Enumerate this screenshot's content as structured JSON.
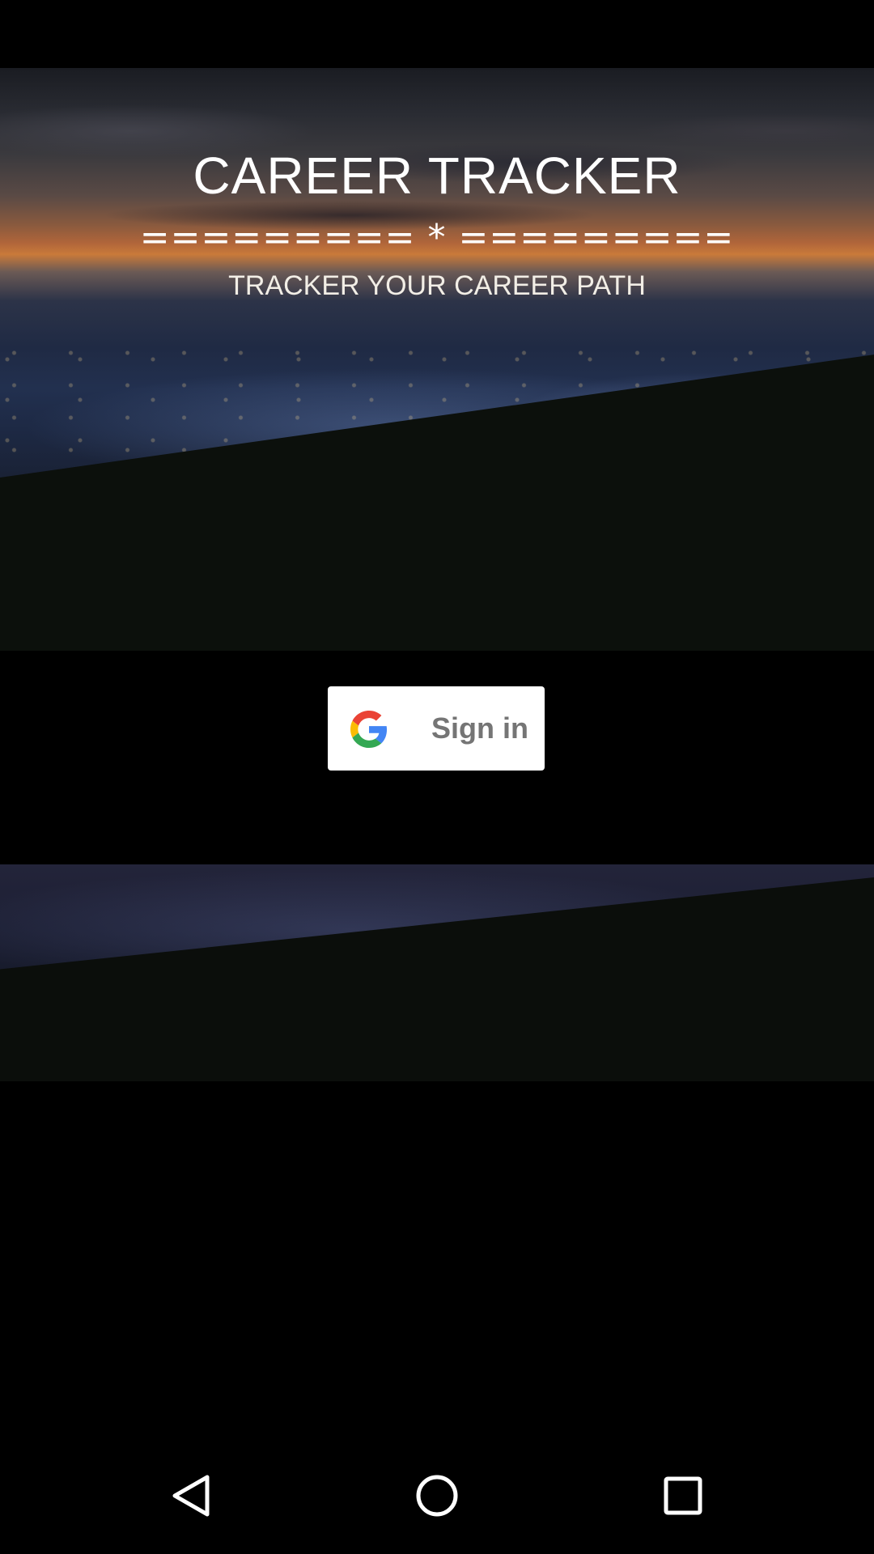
{
  "app": {
    "title": "CAREER TRACKER",
    "divider": "========= * =========",
    "tagline": "TRACKER YOUR CAREER PATH"
  },
  "signin": {
    "label": "Sign in",
    "icon": "google-g-icon"
  },
  "navigation": {
    "back_icon": "back-triangle-icon",
    "home_icon": "home-circle-icon",
    "recent_icon": "recent-apps-square-icon"
  },
  "colors": {
    "background": "#000000",
    "button_bg": "#ffffff",
    "button_text": "#757575",
    "title_text": "#ffffff"
  }
}
